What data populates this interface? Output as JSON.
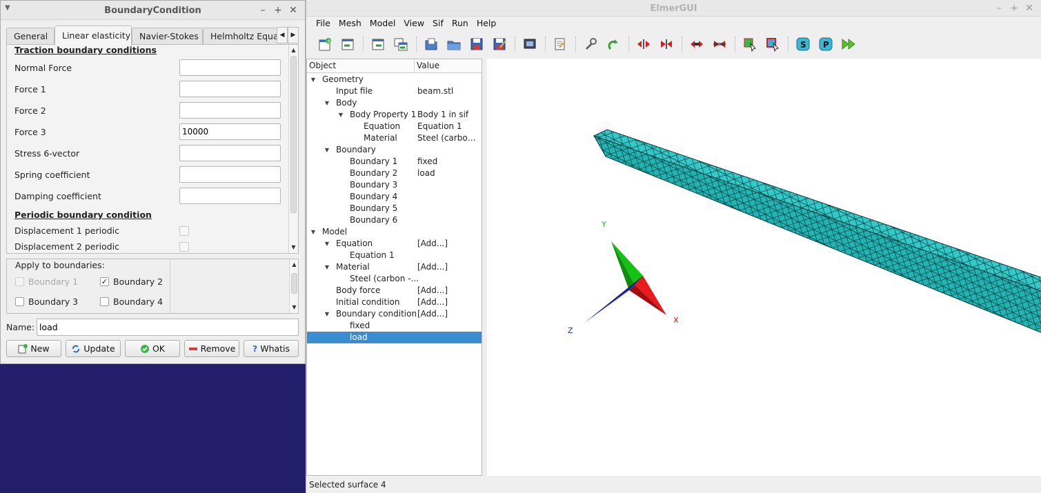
{
  "main_window": {
    "title": "ElmerGUI",
    "menu": [
      "File",
      "Mesh",
      "Model",
      "View",
      "Sif",
      "Run",
      "Help"
    ],
    "toolbar_icons": [
      "new-mesh-icon",
      "open-mesh-icon",
      "load-mesh-icon",
      "import-mesh-icon",
      "open-project-icon",
      "open-folder-icon",
      "save-icon",
      "save-as-icon",
      "screenshot-icon",
      "edit-sif-icon",
      "settings-wrench-icon",
      "redo-icon",
      "unify-red-icon",
      "divide-red-icon",
      "arrows-out-icon",
      "arrows-in-icon",
      "select-surface-icon",
      "select-edge-icon",
      "solver-s-icon",
      "postprocessor-p-icon",
      "run-fast-forward-icon"
    ],
    "status": "Selected surface 4"
  },
  "tree": {
    "columns": [
      "Object",
      "Value"
    ],
    "rows": [
      {
        "depth": 0,
        "arrow": "▼",
        "object": "Geometry",
        "value": ""
      },
      {
        "depth": 1,
        "arrow": "",
        "object": "Input file",
        "value": "beam.stl"
      },
      {
        "depth": 1,
        "arrow": "▼",
        "object": "Body",
        "value": ""
      },
      {
        "depth": 2,
        "arrow": "▼",
        "object": "Body Property 1",
        "value": "Body 1 in sif"
      },
      {
        "depth": 3,
        "arrow": "",
        "object": "Equation",
        "value": "Equation 1"
      },
      {
        "depth": 3,
        "arrow": "",
        "object": "Material",
        "value": "Steel (carbon ..."
      },
      {
        "depth": 1,
        "arrow": "▼",
        "object": "Boundary",
        "value": ""
      },
      {
        "depth": 2,
        "arrow": "",
        "object": "Boundary 1",
        "value": "fixed"
      },
      {
        "depth": 2,
        "arrow": "",
        "object": "Boundary 2",
        "value": "load"
      },
      {
        "depth": 2,
        "arrow": "",
        "object": "Boundary 3",
        "value": ""
      },
      {
        "depth": 2,
        "arrow": "",
        "object": "Boundary 4",
        "value": ""
      },
      {
        "depth": 2,
        "arrow": "",
        "object": "Boundary 5",
        "value": ""
      },
      {
        "depth": 2,
        "arrow": "",
        "object": "Boundary 6",
        "value": ""
      },
      {
        "depth": 0,
        "arrow": "▼",
        "object": "Model",
        "value": ""
      },
      {
        "depth": 1,
        "arrow": "▼",
        "object": "Equation",
        "value": "[Add...]"
      },
      {
        "depth": 2,
        "arrow": "",
        "object": "Equation 1",
        "value": ""
      },
      {
        "depth": 1,
        "arrow": "▼",
        "object": "Material",
        "value": "[Add...]"
      },
      {
        "depth": 2,
        "arrow": "",
        "object": "Steel (carbon -...",
        "value": ""
      },
      {
        "depth": 1,
        "arrow": "",
        "object": "Body force",
        "value": "[Add...]"
      },
      {
        "depth": 1,
        "arrow": "",
        "object": "Initial condition",
        "value": "[Add...]"
      },
      {
        "depth": 1,
        "arrow": "▼",
        "object": "Boundary condition",
        "value": "[Add...]"
      },
      {
        "depth": 2,
        "arrow": "",
        "object": "fixed",
        "value": ""
      },
      {
        "depth": 2,
        "arrow": "",
        "object": "load",
        "value": "",
        "selected": true
      }
    ]
  },
  "viewport": {
    "axes": {
      "x": "X",
      "y": "Y",
      "z": "Z"
    },
    "mesh_color": "#2ec4c4",
    "selected_face_color": "#e02020"
  },
  "dialog": {
    "title": "BoundaryCondition",
    "tabs": [
      "General",
      "Linear elasticity",
      "Navier-Stokes",
      "Helmholtz Equati"
    ],
    "active_tab": 1,
    "sections": {
      "traction": "Traction boundary conditions",
      "periodic": "Periodic boundary condition"
    },
    "fields": [
      {
        "label": "Normal Force",
        "value": ""
      },
      {
        "label": "Force 1",
        "value": ""
      },
      {
        "label": "Force 2",
        "value": ""
      },
      {
        "label": "Force 3",
        "value": "10000"
      },
      {
        "label": "Stress 6-vector",
        "value": ""
      },
      {
        "label": "Spring coefficient",
        "value": ""
      },
      {
        "label": "Damping coefficient",
        "value": ""
      }
    ],
    "periodic_fields": [
      {
        "label": "Displacement 1 periodic"
      },
      {
        "label": "Displacement 2 periodic"
      }
    ],
    "apply_title": "Apply to boundaries:",
    "boundaries": [
      {
        "label": "Boundary 1",
        "checked": false,
        "disabled": true
      },
      {
        "label": "Boundary 2",
        "checked": true,
        "disabled": false
      },
      {
        "label": "Boundary 3",
        "checked": false,
        "disabled": false
      },
      {
        "label": "Boundary 4",
        "checked": false,
        "disabled": false
      }
    ],
    "name_label": "Name:",
    "name_value": "load",
    "buttons": {
      "new": "New",
      "update": "Update",
      "ok": "OK",
      "remove": "Remove",
      "whatis": "Whatis"
    }
  }
}
